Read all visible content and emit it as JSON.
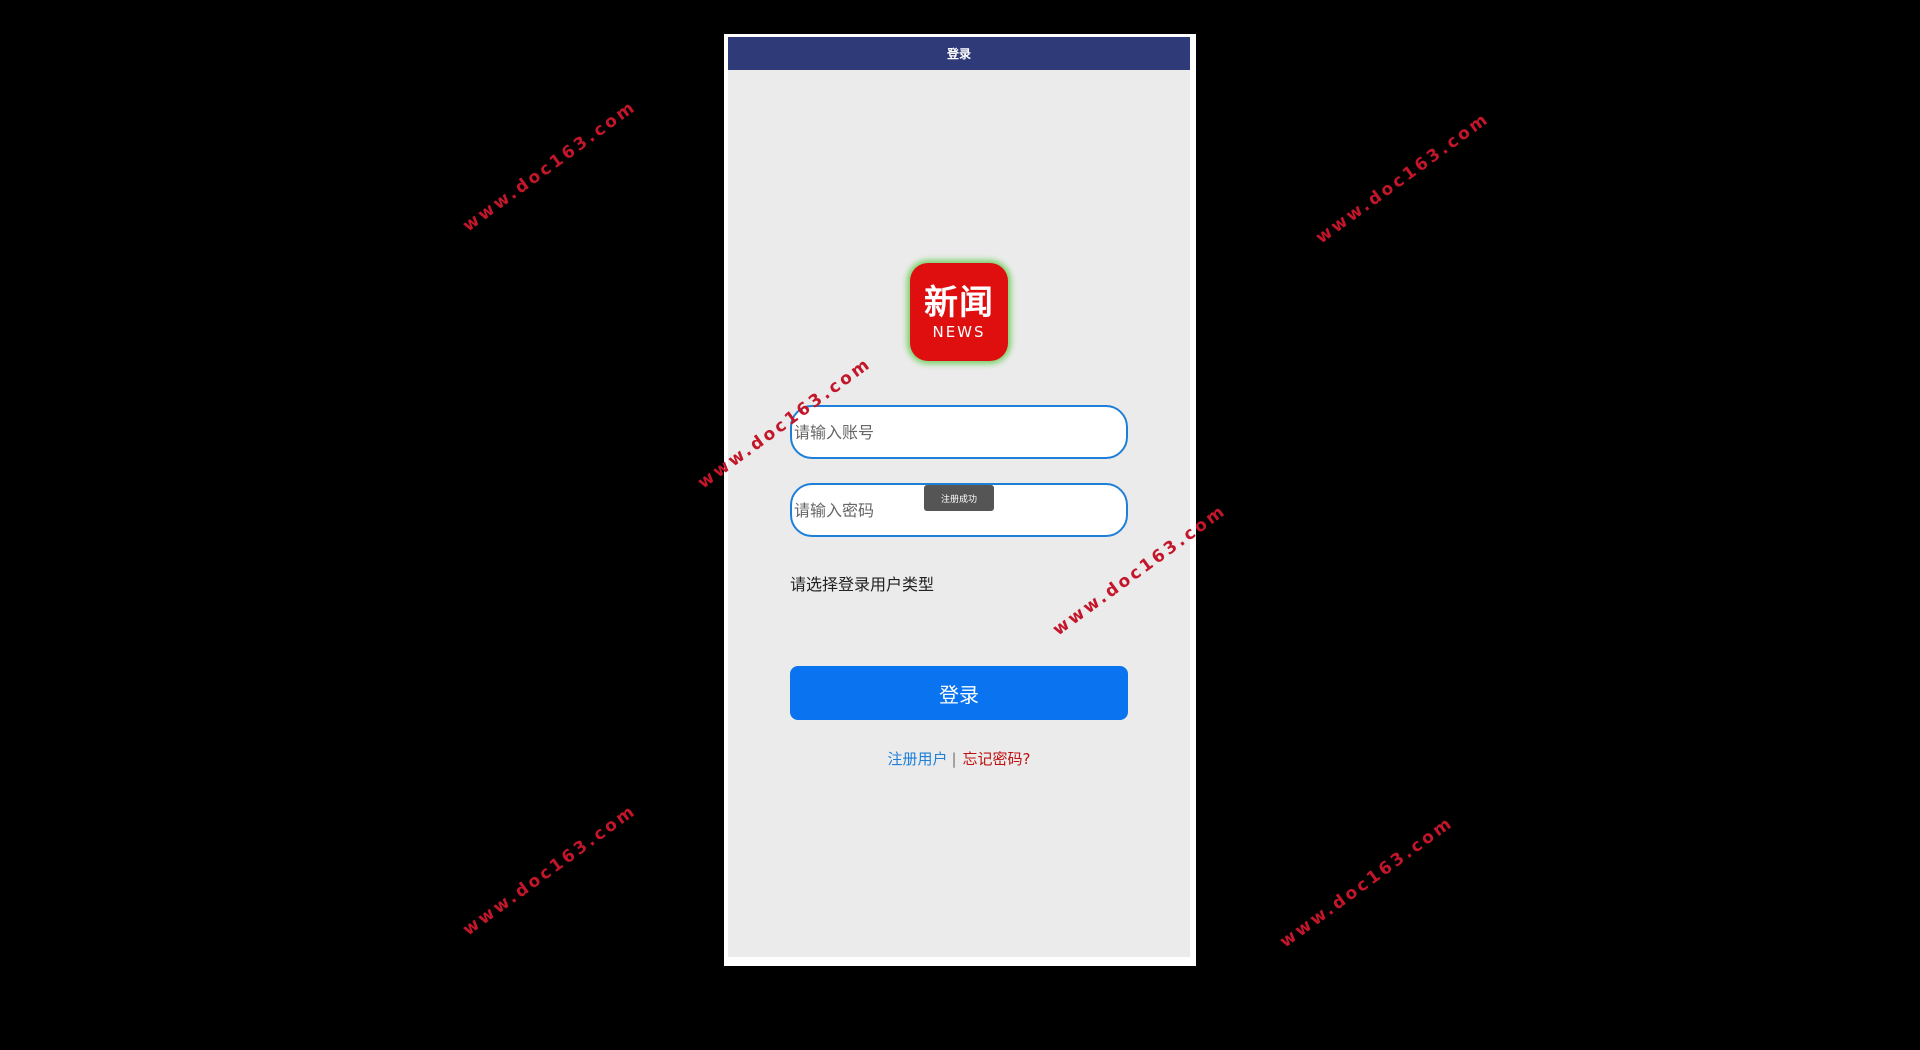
{
  "titlebar": {
    "title": "登录"
  },
  "logo": {
    "cn_text": "新闻",
    "en_text": "NEWS"
  },
  "form": {
    "account_placeholder": "请输入账号",
    "password_placeholder": "请输入密码",
    "user_type_label": "请选择登录用户类型",
    "login_button": "登录"
  },
  "toast": {
    "message": "注册成功"
  },
  "links": {
    "register": "注册用户",
    "separator": "|",
    "forgot": "忘记密码?"
  },
  "watermark": {
    "text": "www.doc163.com"
  },
  "colors": {
    "titlebar": "#2f3a78",
    "primary_button": "#0a73ef",
    "input_border": "#1e7fd8",
    "logo_bg": "#e00f0f",
    "forgot_link": "#c01010",
    "watermark": "#c4162a"
  }
}
